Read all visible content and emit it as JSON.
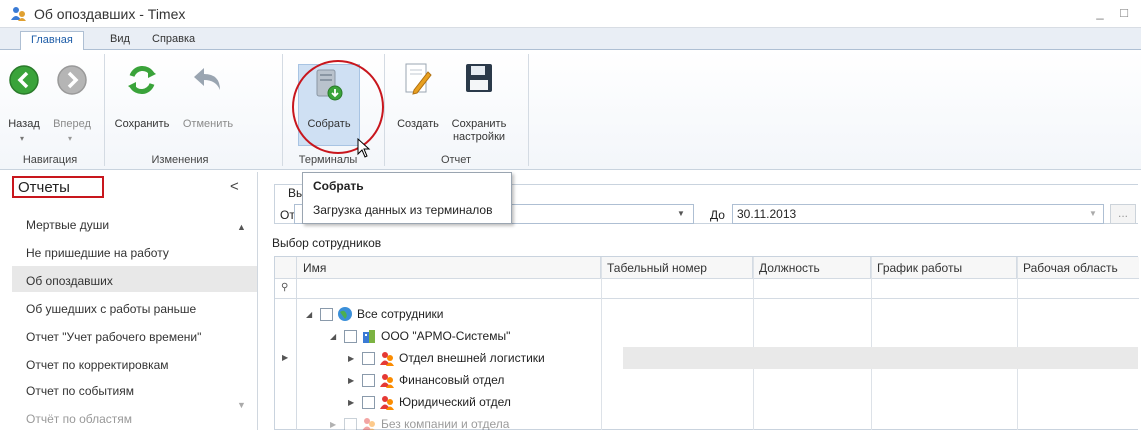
{
  "window": {
    "title": "Об опоздавших - Timex",
    "minimize": "_",
    "maximize": "□"
  },
  "tabs": [
    {
      "label": "Главная",
      "active": true
    },
    {
      "label": "Вид",
      "active": false
    },
    {
      "label": "Справка",
      "active": false
    }
  ],
  "ribbon": {
    "back": "Назад",
    "forward": "Вперед",
    "save": "Сохранить",
    "undo": "Отменить",
    "collect": "Собрать",
    "create": "Создать",
    "save_settings_line1": "Сохранить",
    "save_settings_line2": "настройки",
    "groups": {
      "navigation": "Навигация",
      "changes": "Изменения",
      "terminals": "Терминалы",
      "report": "Отчет"
    }
  },
  "tooltip": {
    "title": "Собрать",
    "text": "Загрузка данных из терминалов"
  },
  "reports_panel": {
    "header": "Отчеты",
    "collapse": "<",
    "items": [
      {
        "label": "Мертвые души"
      },
      {
        "label": "Не пришедшие на работу"
      },
      {
        "label": "Об опоздавших",
        "selected": true
      },
      {
        "label": "Об ушедших с работы раньше"
      },
      {
        "label": "Отчет \"Учет рабочего времени\""
      },
      {
        "label": "Отчет по корректировкам"
      },
      {
        "label": "Отчет по событиям"
      },
      {
        "label": "Отчёт по областям",
        "faded": true
      }
    ]
  },
  "period": {
    "group_label": "Вы",
    "from_label": "От",
    "to_label": "До",
    "to_value": "30.11.2013",
    "more_button": "..."
  },
  "employees": {
    "label": "Выбор сотрудников",
    "columns": [
      "Имя",
      "Табельный номер",
      "Должность",
      "График работы",
      "Рабочая область"
    ],
    "tree": [
      {
        "label": "Все сотрудники",
        "level": 0,
        "icon": "globe-icon"
      },
      {
        "label": "ООО \"АРМО-Системы\"",
        "level": 1,
        "icon": "company-icon"
      },
      {
        "label": "Отдел внешней логистики",
        "level": 2,
        "icon": "department-icon",
        "current": true
      },
      {
        "label": "Финансовый отдел",
        "level": 2,
        "icon": "department-icon"
      },
      {
        "label": "Юридический отдел",
        "level": 2,
        "icon": "department-icon"
      },
      {
        "label": "Без компании и отдела",
        "level": 1,
        "icon": "department-icon",
        "faded": true
      }
    ]
  },
  "colors": {
    "accent_blue": "#1e5da8",
    "highlight_red": "#c8161d",
    "ribbon_selected": "#cfe0f3"
  }
}
